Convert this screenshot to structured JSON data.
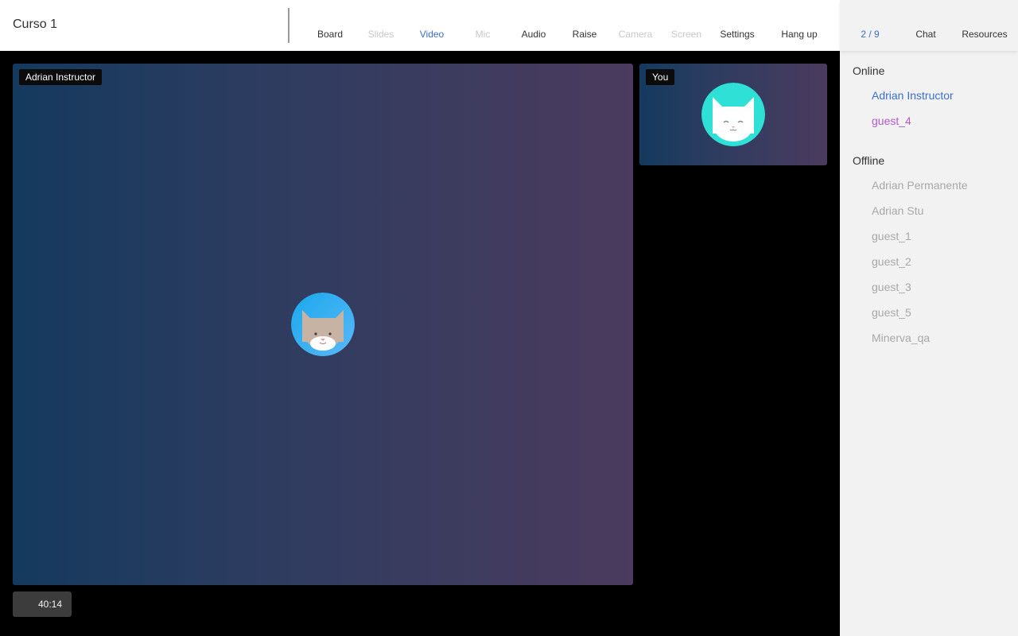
{
  "header": {
    "title": "Curso 1",
    "tools": [
      {
        "label": "Board",
        "state": "normal"
      },
      {
        "label": "Slides",
        "state": "disabled"
      },
      {
        "label": "Video",
        "state": "active"
      },
      {
        "label": "Mic",
        "state": "disabled"
      },
      {
        "label": "Audio",
        "state": "normal"
      },
      {
        "label": "Raise",
        "state": "normal"
      },
      {
        "label": "Camera",
        "state": "disabled"
      },
      {
        "label": "Screen",
        "state": "disabled"
      },
      {
        "label": "Settings",
        "state": "normal"
      },
      {
        "label": "Hang up",
        "state": "normal"
      }
    ]
  },
  "sidebar": {
    "count": "2 / 9",
    "tabs": [
      "Chat",
      "Resources"
    ],
    "online_title": "Online",
    "online": [
      "Adrian Instructor",
      "guest_4"
    ],
    "offline_title": "Offline",
    "offline": [
      "Adrian Permanente",
      "Adrian Stu",
      "guest_1",
      "guest_2",
      "guest_3",
      "guest_5",
      "Minerva_qa"
    ]
  },
  "videos": {
    "main_label": "Adrian Instructor",
    "self_label": "You"
  },
  "timer": "40:14",
  "colors": {
    "accent": "#3a6fd0",
    "online_guest": "#b05ad0",
    "offline": "#a8a8a8",
    "avatar_main": "#2fb4f0",
    "avatar_self": "#2fe0d6"
  }
}
